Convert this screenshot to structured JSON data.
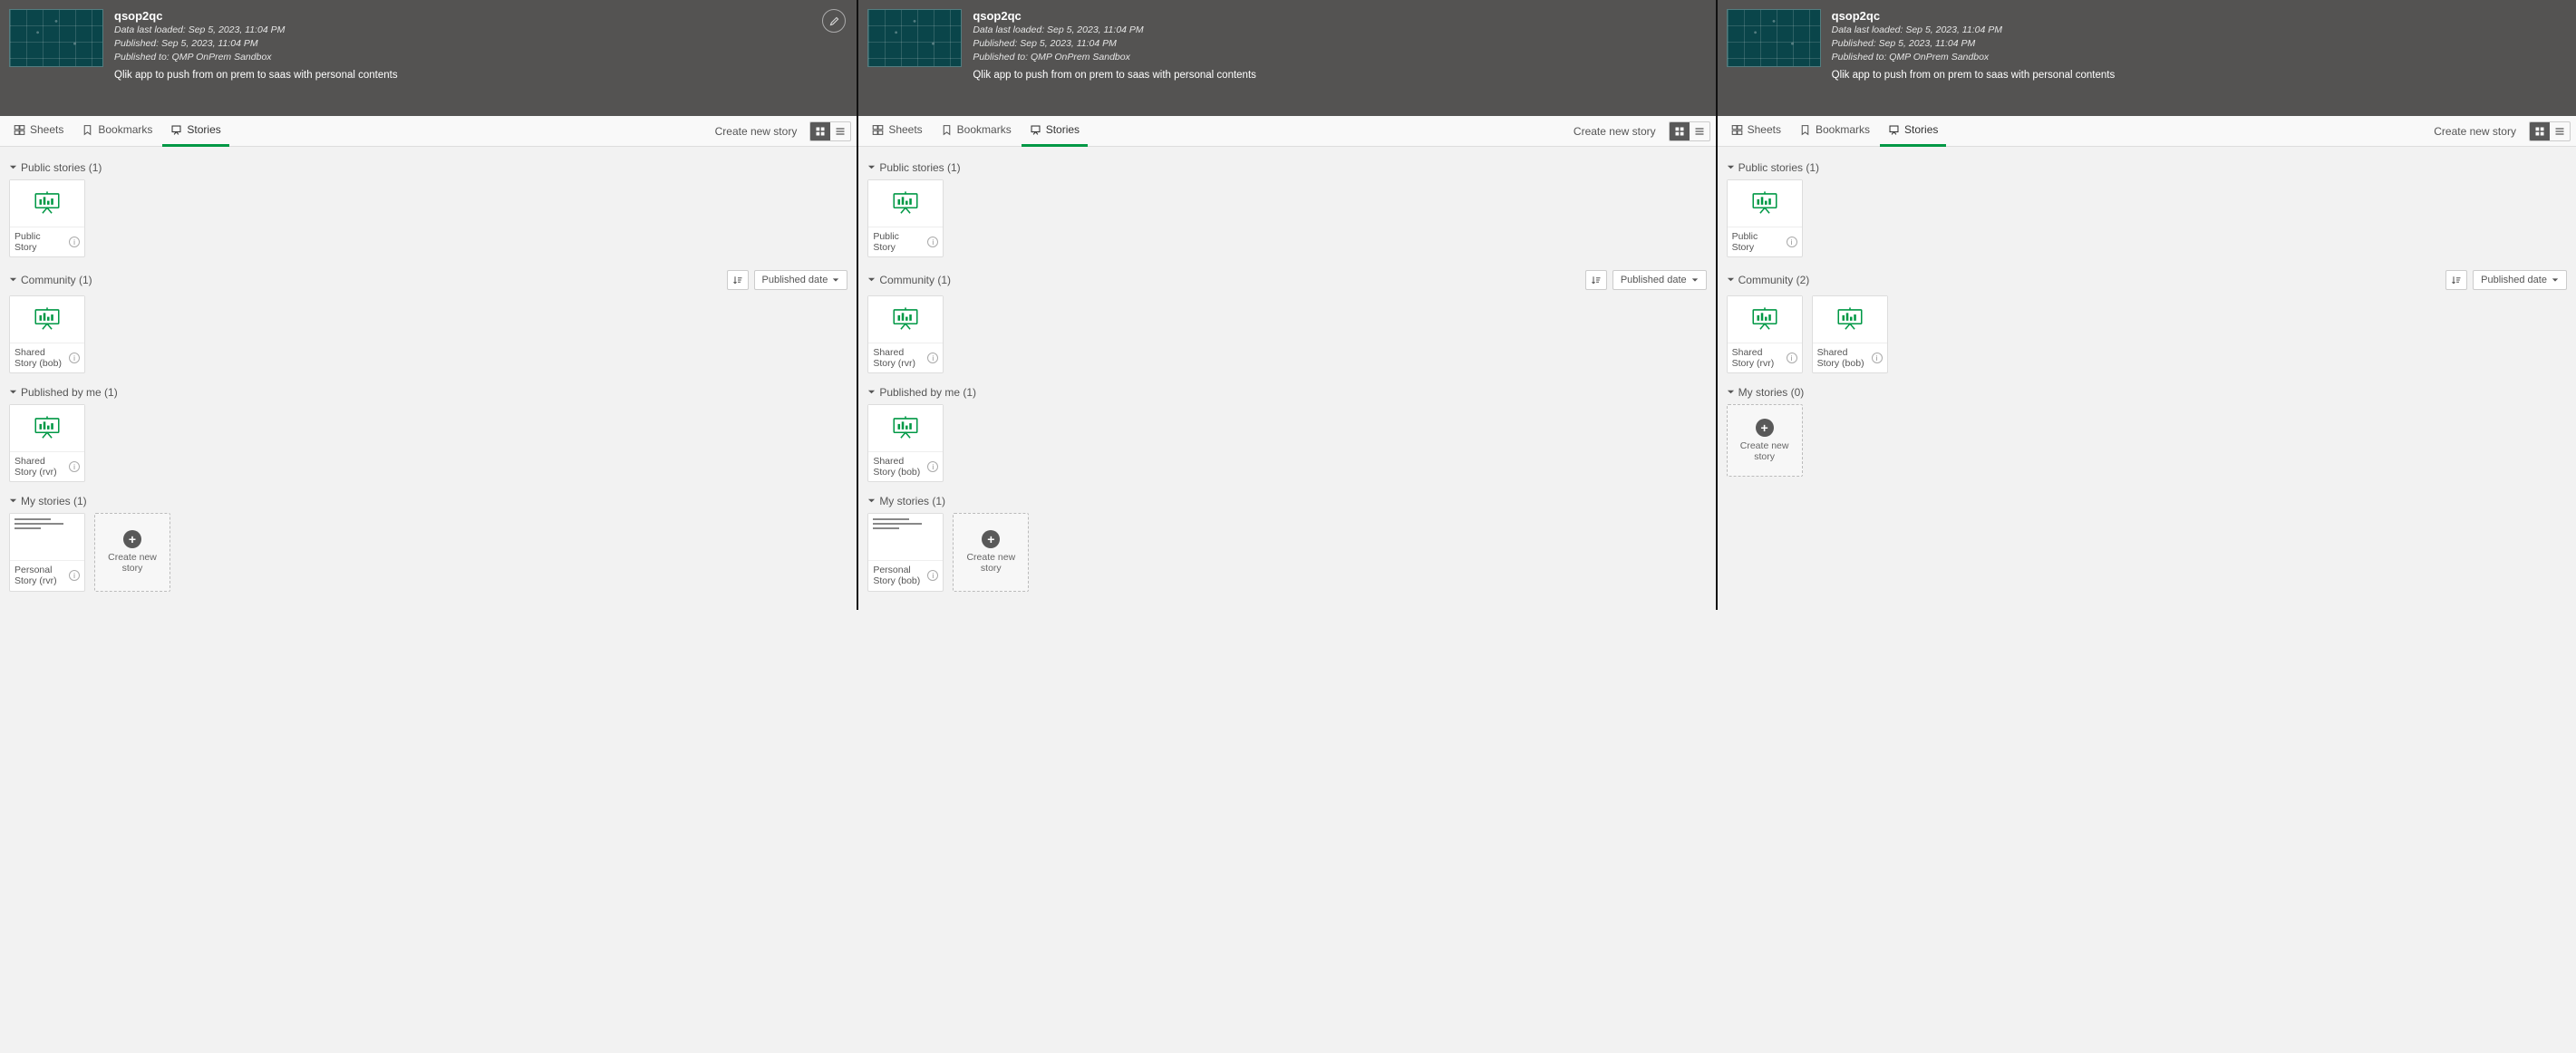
{
  "app": {
    "title": "qsop2qc",
    "meta1": "Data last loaded: Sep 5, 2023, 11:04 PM",
    "meta2": "Published: Sep 5, 2023, 11:04 PM",
    "meta3": "Published to: QMP OnPrem Sandbox",
    "desc": "Qlik app to push from on prem to saas with personal contents"
  },
  "tabs": {
    "sheets": "Sheets",
    "bookmarks": "Bookmarks",
    "stories": "Stories",
    "createStory": "Create new story"
  },
  "sort": {
    "label": "Published date"
  },
  "newCard": "Create new story",
  "panels": [
    {
      "showEdit": true,
      "sections": [
        {
          "title": "Public stories (1)",
          "hasSort": false,
          "cards": [
            {
              "kind": "chart",
              "label": "Public Story"
            }
          ]
        },
        {
          "title": "Community (1)",
          "hasSort": true,
          "cards": [
            {
              "kind": "chart",
              "label": "Shared Story (bob)"
            }
          ]
        },
        {
          "title": "Published by me (1)",
          "hasSort": false,
          "cards": [
            {
              "kind": "chart",
              "label": "Shared Story (rvr)"
            }
          ]
        },
        {
          "title": "My stories (1)",
          "hasSort": false,
          "cards": [
            {
              "kind": "text",
              "label": "Personal Story (rvr)"
            },
            {
              "kind": "new"
            }
          ]
        }
      ]
    },
    {
      "showEdit": false,
      "sections": [
        {
          "title": "Public stories (1)",
          "hasSort": false,
          "cards": [
            {
              "kind": "chart",
              "label": "Public Story"
            }
          ]
        },
        {
          "title": "Community (1)",
          "hasSort": true,
          "cards": [
            {
              "kind": "chart",
              "label": "Shared Story (rvr)"
            }
          ]
        },
        {
          "title": "Published by me (1)",
          "hasSort": false,
          "cards": [
            {
              "kind": "chart",
              "label": "Shared Story (bob)"
            }
          ]
        },
        {
          "title": "My stories (1)",
          "hasSort": false,
          "cards": [
            {
              "kind": "text",
              "label": "Personal Story (bob)"
            },
            {
              "kind": "new"
            }
          ]
        }
      ]
    },
    {
      "showEdit": false,
      "sections": [
        {
          "title": "Public stories (1)",
          "hasSort": false,
          "cards": [
            {
              "kind": "chart",
              "label": "Public Story"
            }
          ]
        },
        {
          "title": "Community (2)",
          "hasSort": true,
          "cards": [
            {
              "kind": "chart",
              "label": "Shared Story (rvr)"
            },
            {
              "kind": "chart",
              "label": "Shared Story (bob)"
            }
          ]
        },
        {
          "title": "My stories (0)",
          "hasSort": false,
          "cards": [
            {
              "kind": "new"
            }
          ]
        }
      ]
    }
  ]
}
